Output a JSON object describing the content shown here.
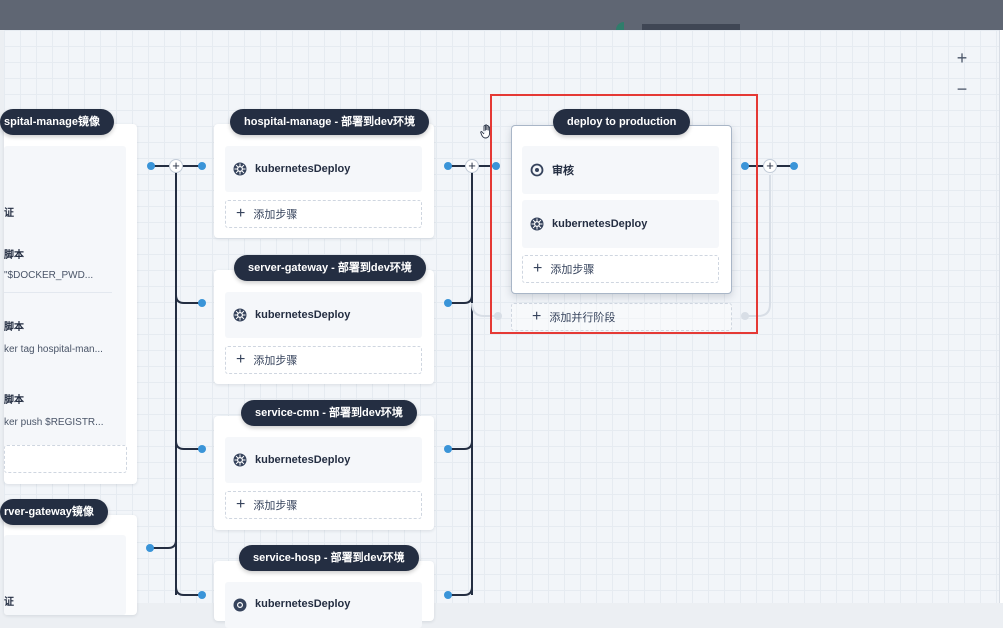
{
  "stage_left_1": {
    "title": "spital-manage镜像",
    "items": [
      {
        "label": "证",
        "code": ""
      },
      {
        "label": "脚本",
        "code": "\"$DOCKER_PWD..."
      },
      {
        "label": "脚本",
        "code": "ker tag hospital-man..."
      },
      {
        "label": "脚本",
        "code": "ker push $REGISTR..."
      }
    ]
  },
  "stage_left_2": {
    "title": "rver-gateway镜像",
    "items": [
      {
        "label": "证"
      }
    ]
  },
  "deploy_dev": [
    {
      "title": "hospital-manage - 部署到dev环境",
      "step": "kubernetesDeploy",
      "add_step": "添加步骤"
    },
    {
      "title": "server-gateway - 部署到dev环境",
      "step": "kubernetesDeploy",
      "add_step": "添加步骤"
    },
    {
      "title": "service-cmn - 部署到dev环境",
      "step": "kubernetesDeploy",
      "add_step": "添加步骤"
    },
    {
      "title": "service-hosp - 部署到dev环境",
      "step": "kubernetesDeploy"
    }
  ],
  "production": {
    "title": "deploy to production",
    "steps": [
      {
        "label": "审核",
        "icon": "review-icon"
      },
      {
        "label": "kubernetesDeploy",
        "icon": "kubernetes-icon"
      }
    ],
    "add_step": "添加步骤",
    "add_parallel": "添加并行阶段"
  },
  "zoom": {
    "in": "+",
    "out": "−"
  },
  "node_plus": "+",
  "colors": {
    "pill": "#242e42",
    "dot": "#3a94d8",
    "highlight": "#e53935"
  }
}
